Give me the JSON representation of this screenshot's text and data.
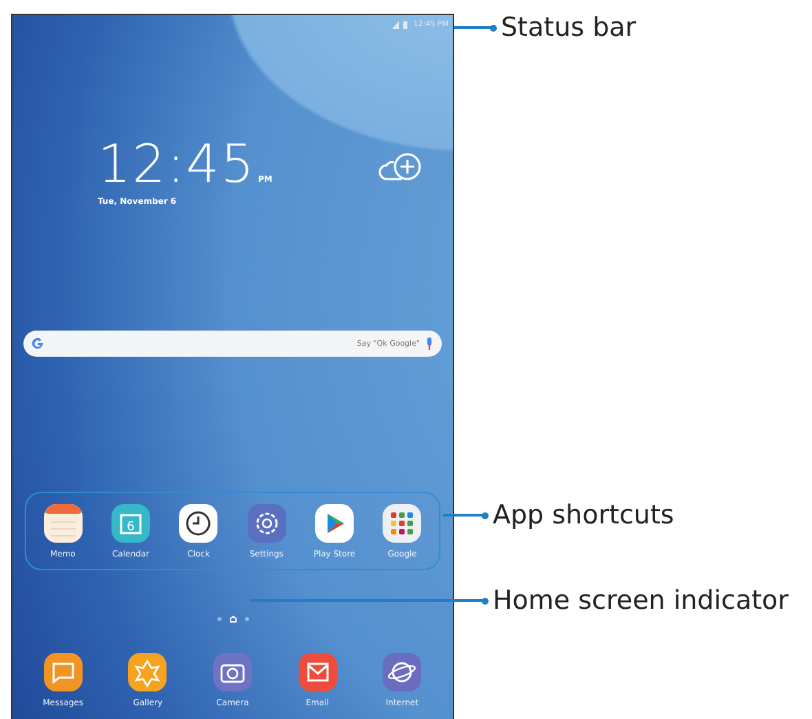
{
  "status_bar": {
    "time": "12:45 PM"
  },
  "clock": {
    "time": "12:45",
    "ampm": "PM",
    "date": "Tue, November 6"
  },
  "search": {
    "placeholder": "Say \"Ok Google\""
  },
  "app_shortcuts": [
    {
      "kind": "memo",
      "label": "Memo"
    },
    {
      "kind": "calendar",
      "label": "Calendar",
      "day": "6"
    },
    {
      "kind": "clock",
      "label": "Clock"
    },
    {
      "kind": "settings",
      "label": "Settings"
    },
    {
      "kind": "play",
      "label": "Play Store"
    },
    {
      "kind": "folder",
      "label": "Google"
    }
  ],
  "page_indicator": [
    {
      "kind": "dot",
      "selected": false
    },
    {
      "kind": "home",
      "selected": true
    },
    {
      "kind": "dot",
      "selected": false
    }
  ],
  "dock": [
    {
      "kind": "messages",
      "label": "Messages"
    },
    {
      "kind": "gallery",
      "label": "Gallery"
    },
    {
      "kind": "camera",
      "label": "Camera"
    },
    {
      "kind": "email",
      "label": "Email"
    },
    {
      "kind": "internet",
      "label": "Internet"
    }
  ],
  "callouts": [
    {
      "label": "Status bar"
    },
    {
      "label": "App shortcuts"
    },
    {
      "label": "Home screen indicator"
    }
  ]
}
